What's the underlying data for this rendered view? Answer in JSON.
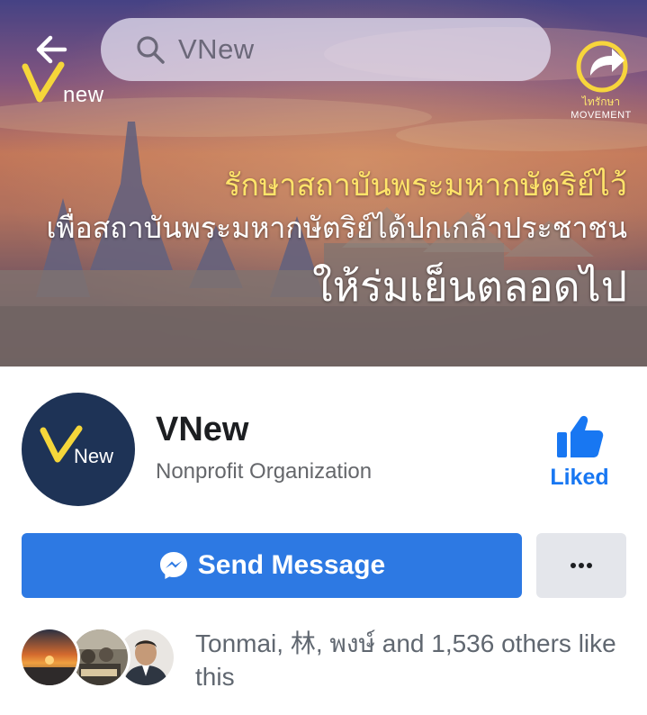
{
  "search": {
    "query": "VNew"
  },
  "cover": {
    "logo_text": "new",
    "movement_th": "ไทรักษา",
    "movement_en": "MOVEMENT",
    "slogan_line1": "รักษาสถาบันพระมหากษัตริย์ไว้",
    "slogan_line2": "เพื่อสถาบันพระมหากษัตริย์ได้ปกเกล้าประชาชน",
    "slogan_line3": "ให้ร่มเย็นตลอดไป"
  },
  "page": {
    "avatar_text": "New",
    "name": "VNew",
    "category": "Nonprofit Organization",
    "liked_label": "Liked"
  },
  "actions": {
    "send_message": "Send Message",
    "more": "•••"
  },
  "likes": {
    "text": "Tonmai, 林, พงษ์  and 1,536 others like this"
  },
  "colors": {
    "accent": "#1877f2",
    "send_button": "#2d79e3",
    "logo_yellow": "#f5d63a",
    "avatar_bg": "#1e3356"
  },
  "icons": {
    "back": "arrow-left-icon",
    "search": "search-icon",
    "share": "share-icon",
    "like": "thumbs-up-icon",
    "messenger": "messenger-icon",
    "more": "ellipsis-icon"
  }
}
